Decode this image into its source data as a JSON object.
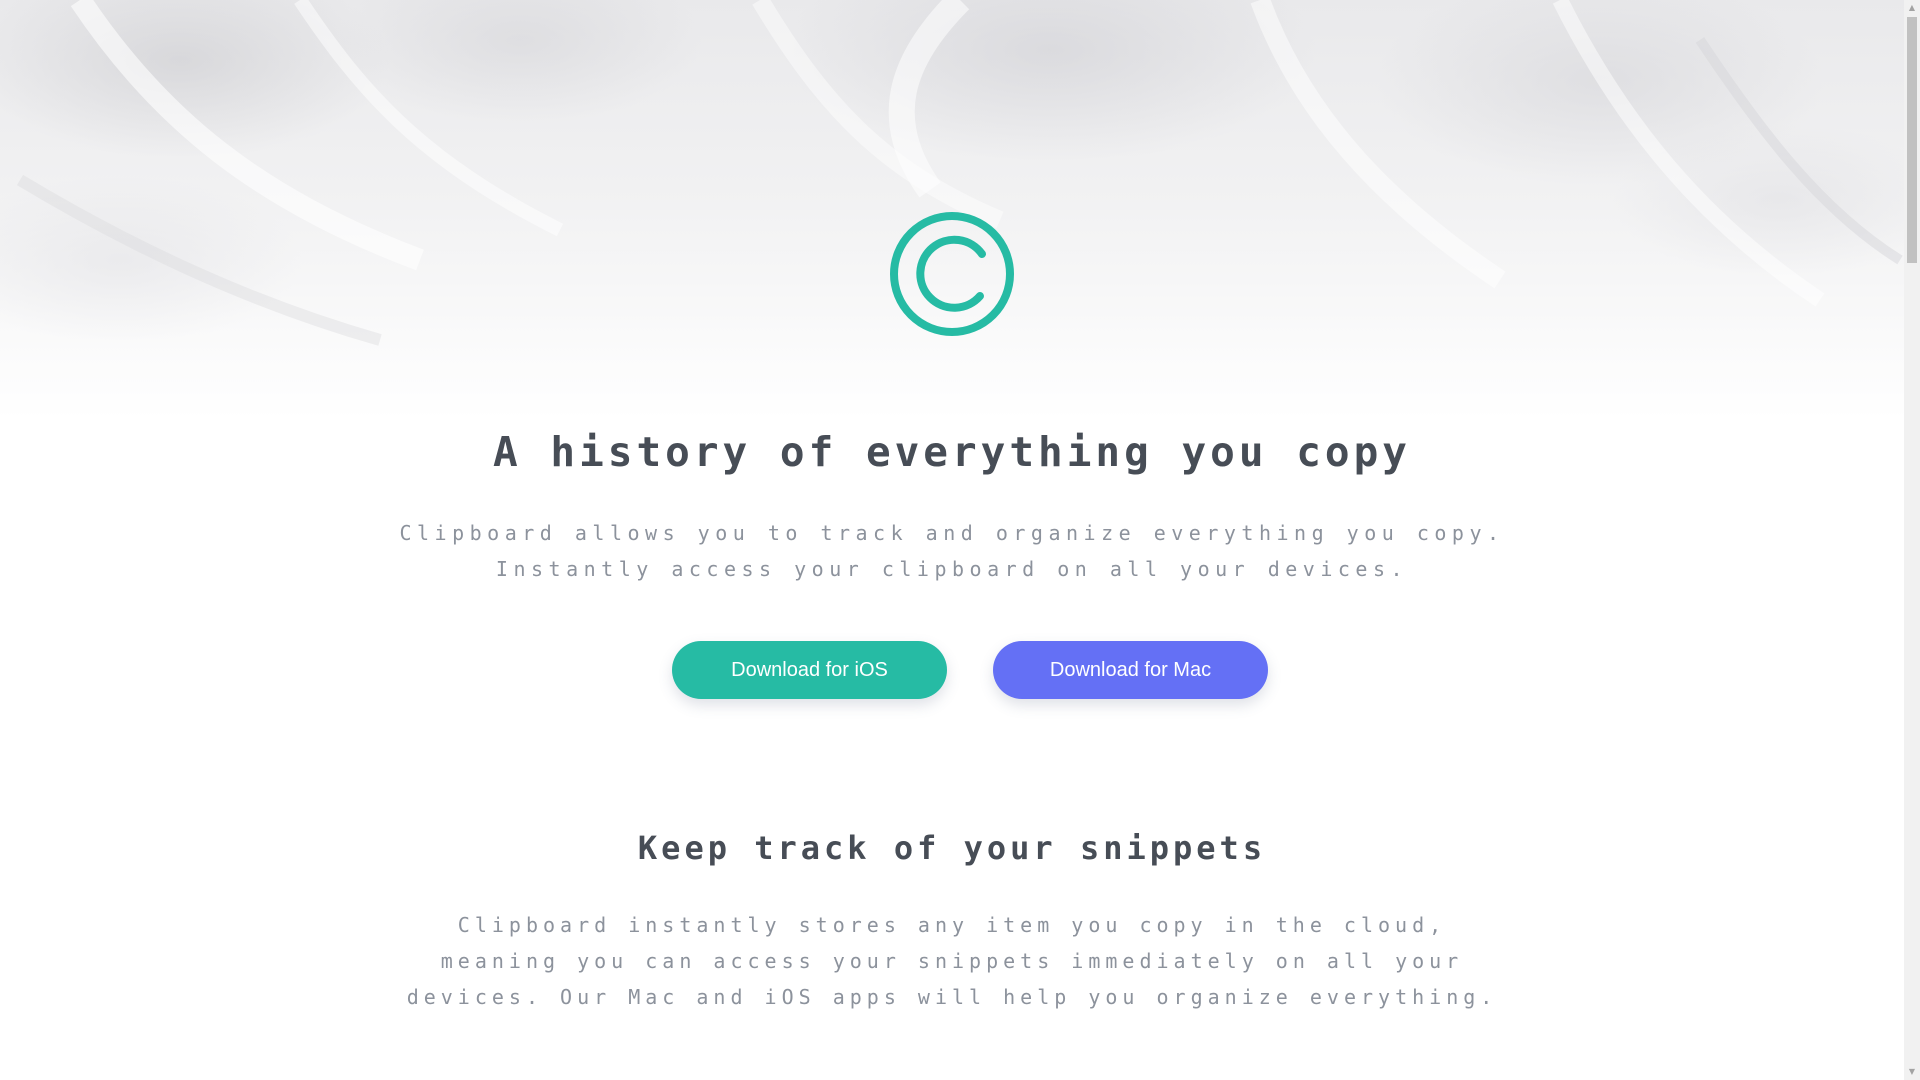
{
  "colors": {
    "accent_teal": "#26bba4",
    "accent_indigo": "#6470f5",
    "heading": "#474d56",
    "body_text": "#8c929c"
  },
  "hero": {
    "logo_icon": "clipboard-c-icon",
    "title": "A history of everything you copy",
    "subtitle": "Clipboard allows you to track and organize everything you copy. Instantly access your clipboard on all your devices.",
    "buttons": {
      "ios": "Download for iOS",
      "mac": "Download for Mac"
    }
  },
  "snippets": {
    "title": "Keep track of your snippets",
    "text": "Clipboard instantly stores any item you copy in the cloud, meaning you can access your snippets immediately on all your devices. Our Mac and iOS apps will help you organize everything."
  },
  "scrollbar": {
    "up_icon": "scroll-up-arrow-icon",
    "down_icon": "scroll-down-arrow-icon"
  }
}
